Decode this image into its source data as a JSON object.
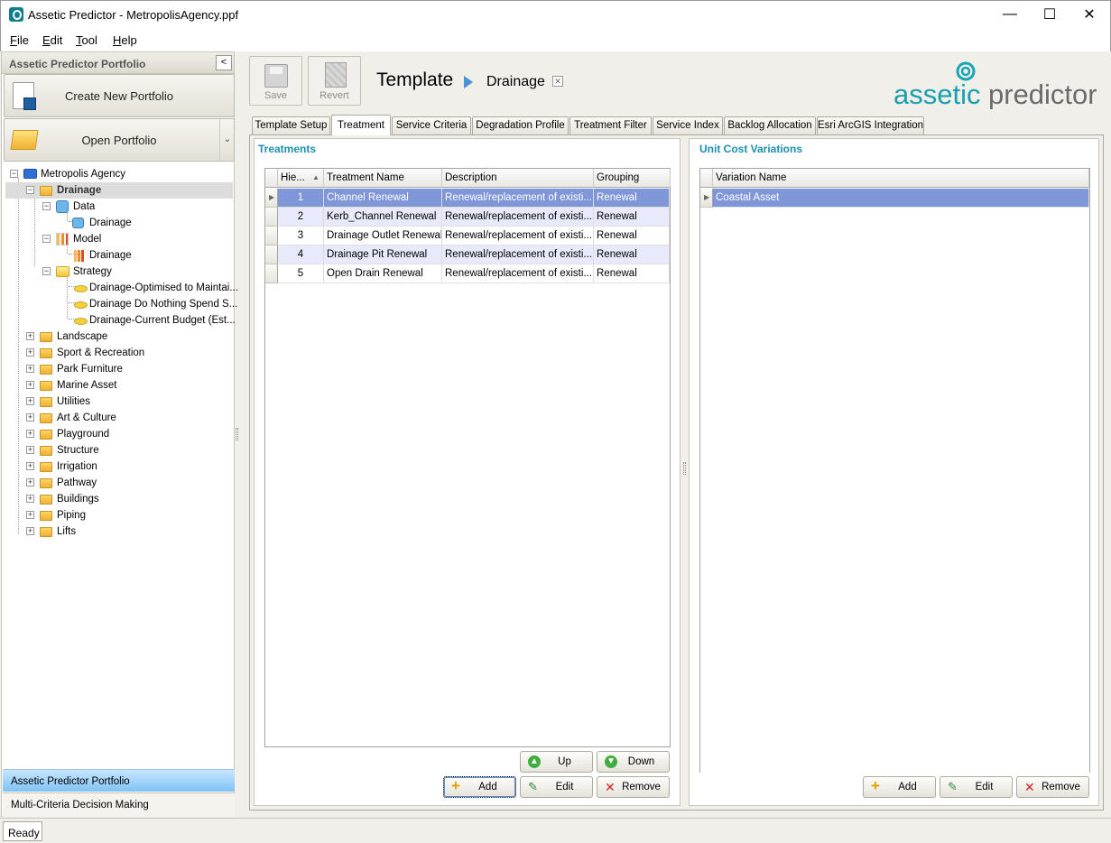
{
  "window": {
    "title": "Assetic Predictor - MetropolisAgency.ppf",
    "minimize": "—",
    "maximize": "☐",
    "close": "✕"
  },
  "menu": {
    "file": "F",
    "file_rest": "ile",
    "edit": "E",
    "edit_rest": "dit",
    "tool": "T",
    "tool_rest": "ool",
    "help": "H",
    "help_rest": "elp"
  },
  "left_panel": {
    "header": "Assetic Predictor Portfolio",
    "create_button": "Create New Portfolio",
    "open_button": "Open Portfolio",
    "tree": {
      "root": "Metropolis Agency",
      "drainage": "Drainage",
      "data": "Data",
      "data_child": "Drainage",
      "model": "Model",
      "model_child": "Drainage",
      "strategy": "Strategy",
      "strategies": [
        "Drainage-Optimised to Maintai...",
        "Drainage Do Nothing Spend S...",
        "Drainage-Current Budget (Est..."
      ],
      "categories": [
        "Landscape",
        "Sport & Recreation",
        "Park Furniture",
        "Marine Asset",
        "Utilities",
        "Art & Culture",
        "Playground",
        "Structure",
        "Irrigation",
        "Pathway",
        "Buildings",
        "Piping",
        "Lifts"
      ]
    },
    "nav": [
      "Assetic Predictor Portfolio",
      "Multi-Criteria Decision Making"
    ]
  },
  "toolbar": {
    "save": "Save",
    "revert": "Revert"
  },
  "breadcrumb": {
    "template": "Template",
    "current": "Drainage",
    "close": "✕"
  },
  "logo": {
    "part1": "assetic",
    "part2": "predictor"
  },
  "tabs": [
    "Template Setup",
    "Treatment",
    "Service Criteria",
    "Degradation Profile",
    "Treatment Filter",
    "Service Index",
    "Backlog Allocation",
    "Esri ArcGIS Integration"
  ],
  "treatments": {
    "title": "Treatments",
    "columns": [
      "Hie...",
      "Treatment Name",
      "Description",
      "Grouping"
    ],
    "rows": [
      {
        "h": "1",
        "name": "Channel Renewal",
        "desc": "Renewal/replacement of existi...",
        "group": "Renewal"
      },
      {
        "h": "2",
        "name": "Kerb_Channel Renewal",
        "desc": "Renewal/replacement of existi...",
        "group": "Renewal"
      },
      {
        "h": "3",
        "name": "Drainage Outlet Renewal",
        "desc": "Renewal/replacement of existi...",
        "group": "Renewal"
      },
      {
        "h": "4",
        "name": "Drainage Pit Renewal",
        "desc": "Renewal/replacement of existi...",
        "group": "Renewal"
      },
      {
        "h": "5",
        "name": "Open Drain Renewal",
        "desc": "Renewal/replacement of existi...",
        "group": "Renewal"
      }
    ],
    "buttons": {
      "up": "Up",
      "down": "Down",
      "add": "Add",
      "edit": "Edit",
      "remove": "Remove"
    }
  },
  "unit_cost": {
    "title": "Unit Cost Variations",
    "column": "Variation Name",
    "rows": [
      "Coastal Asset"
    ],
    "buttons": {
      "add": "Add",
      "edit": "Edit",
      "remove": "Remove"
    }
  },
  "status": "Ready"
}
